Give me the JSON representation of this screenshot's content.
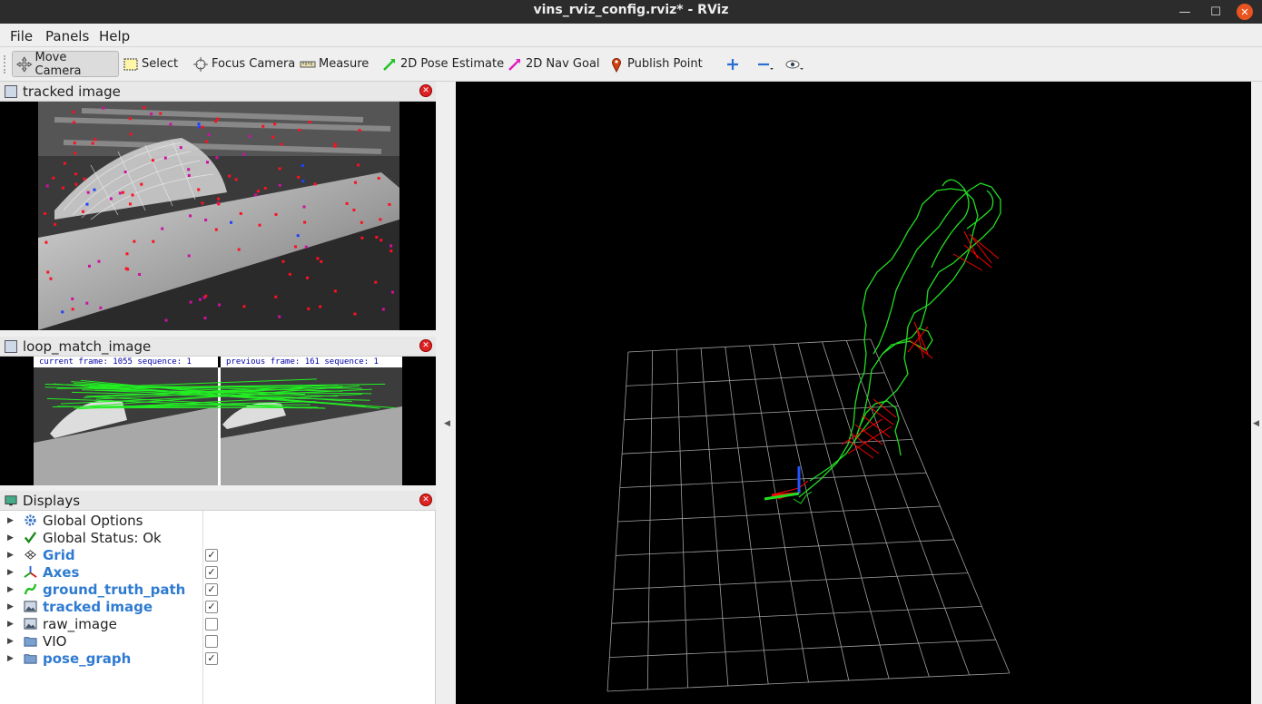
{
  "window": {
    "title": "vins_rviz_config.rviz* - RViz"
  },
  "menu": [
    {
      "label": "File"
    },
    {
      "label": "Panels"
    },
    {
      "label": "Help"
    }
  ],
  "toolbar": {
    "move_camera": "Move Camera",
    "select": "Select",
    "focus_camera": "Focus Camera",
    "measure": "Measure",
    "pose_estimate": "2D Pose Estimate",
    "nav_goal": "2D Nav Goal",
    "publish_point": "Publish Point"
  },
  "panels": {
    "tracked": {
      "title": "tracked image"
    },
    "loop": {
      "title": "loop_match_image",
      "current_label": "current frame: 1055   sequence: 1",
      "previous_label": "previous frame: 161   sequence: 1"
    },
    "displays": {
      "title": "Displays"
    }
  },
  "displays": [
    {
      "label": "Global Options",
      "icon": "gear-icon",
      "enabled": null,
      "highlight": false
    },
    {
      "label": "Global Status: Ok",
      "icon": "checkmark-icon",
      "enabled": null,
      "highlight": false
    },
    {
      "label": "Grid",
      "icon": "grid-icon",
      "enabled": true,
      "highlight": true
    },
    {
      "label": "Axes",
      "icon": "axes-icon",
      "enabled": true,
      "highlight": true
    },
    {
      "label": "ground_truth_path",
      "icon": "path-icon",
      "enabled": true,
      "highlight": true
    },
    {
      "label": "tracked image",
      "icon": "image-icon",
      "enabled": true,
      "highlight": true
    },
    {
      "label": "raw_image",
      "icon": "image-icon",
      "enabled": false,
      "highlight": false
    },
    {
      "label": "VIO",
      "icon": "folder-icon",
      "enabled": false,
      "highlight": false
    },
    {
      "label": "pose_graph",
      "icon": "folder-icon",
      "enabled": true,
      "highlight": true
    }
  ],
  "colors": {
    "accent": "#2f7bd1",
    "path": "#22dd22",
    "loop_edges": "#ff0000",
    "grid": "#a0a0a0"
  }
}
